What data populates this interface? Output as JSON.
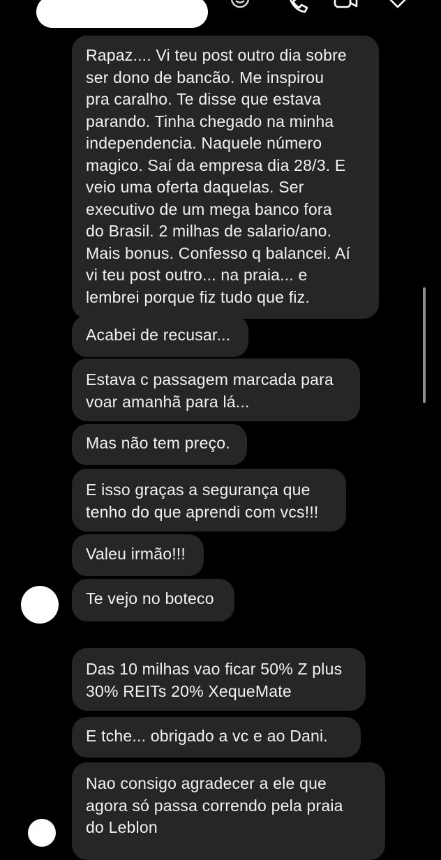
{
  "header": {
    "icons": [
      "emoji-icon",
      "phone-icon",
      "video-icon",
      "heart-icon"
    ]
  },
  "messages": [
    {
      "lines": [
        "Rapaz.... Vi teu post outro dia sobre",
        "ser dono de bancão. Me inspirou",
        "pra caralho. Te disse que estava",
        "parando. Tinha chegado na minha",
        "independencia. Naquele número",
        "magico. Saí da empresa dia 28/3. E",
        "veio uma oferta daquelas. Ser",
        "executivo de um mega banco fora",
        "do Brasil. 2 milhas de salario/ano.",
        "Mais bonus. Confesso q balancei. Aí",
        "vi teu post outro... na praia... e",
        "lembrei porque fiz tudo que fiz."
      ]
    },
    {
      "lines": [
        "Acabei de recusar..."
      ]
    },
    {
      "lines": [
        "Estava c passagem marcada para",
        "voar amanhã para lá..."
      ]
    },
    {
      "lines": [
        "Mas não tem preço."
      ]
    },
    {
      "lines": [
        "E isso graças a segurança que",
        "tenho do que aprendi com vcs!!!"
      ]
    },
    {
      "lines": [
        "Valeu irmão!!!"
      ]
    },
    {
      "lines": [
        "Te vejo no boteco"
      ]
    },
    {
      "lines": [
        "Das 10 milhas vao ficar 50% Z plus",
        "30% REITs 20% XequeMate"
      ]
    },
    {
      "lines": [
        "E tche... obrigado a vc e ao Dani."
      ]
    },
    {
      "lines": [
        "Nao consigo agradecer a ele que",
        "agora só passa correndo pela praia",
        "do Leblon"
      ]
    }
  ],
  "colors": {
    "background": "#000000",
    "bubble": "#262626",
    "text": "#f2f2f2"
  }
}
